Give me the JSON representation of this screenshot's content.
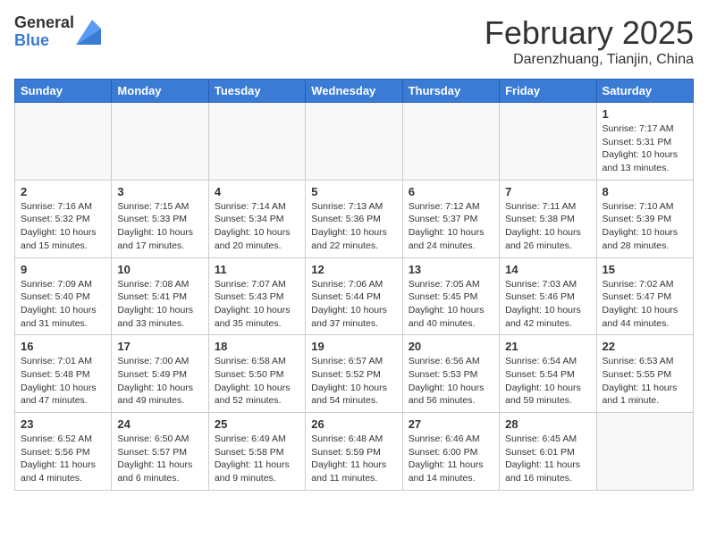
{
  "logo": {
    "general": "General",
    "blue": "Blue"
  },
  "title": "February 2025",
  "location": "Darenzhuang, Tianjin, China",
  "weekdays": [
    "Sunday",
    "Monday",
    "Tuesday",
    "Wednesday",
    "Thursday",
    "Friday",
    "Saturday"
  ],
  "weeks": [
    [
      {
        "day": "",
        "info": ""
      },
      {
        "day": "",
        "info": ""
      },
      {
        "day": "",
        "info": ""
      },
      {
        "day": "",
        "info": ""
      },
      {
        "day": "",
        "info": ""
      },
      {
        "day": "",
        "info": ""
      },
      {
        "day": "1",
        "info": "Sunrise: 7:17 AM\nSunset: 5:31 PM\nDaylight: 10 hours\nand 13 minutes."
      }
    ],
    [
      {
        "day": "2",
        "info": "Sunrise: 7:16 AM\nSunset: 5:32 PM\nDaylight: 10 hours\nand 15 minutes."
      },
      {
        "day": "3",
        "info": "Sunrise: 7:15 AM\nSunset: 5:33 PM\nDaylight: 10 hours\nand 17 minutes."
      },
      {
        "day": "4",
        "info": "Sunrise: 7:14 AM\nSunset: 5:34 PM\nDaylight: 10 hours\nand 20 minutes."
      },
      {
        "day": "5",
        "info": "Sunrise: 7:13 AM\nSunset: 5:36 PM\nDaylight: 10 hours\nand 22 minutes."
      },
      {
        "day": "6",
        "info": "Sunrise: 7:12 AM\nSunset: 5:37 PM\nDaylight: 10 hours\nand 24 minutes."
      },
      {
        "day": "7",
        "info": "Sunrise: 7:11 AM\nSunset: 5:38 PM\nDaylight: 10 hours\nand 26 minutes."
      },
      {
        "day": "8",
        "info": "Sunrise: 7:10 AM\nSunset: 5:39 PM\nDaylight: 10 hours\nand 28 minutes."
      }
    ],
    [
      {
        "day": "9",
        "info": "Sunrise: 7:09 AM\nSunset: 5:40 PM\nDaylight: 10 hours\nand 31 minutes."
      },
      {
        "day": "10",
        "info": "Sunrise: 7:08 AM\nSunset: 5:41 PM\nDaylight: 10 hours\nand 33 minutes."
      },
      {
        "day": "11",
        "info": "Sunrise: 7:07 AM\nSunset: 5:43 PM\nDaylight: 10 hours\nand 35 minutes."
      },
      {
        "day": "12",
        "info": "Sunrise: 7:06 AM\nSunset: 5:44 PM\nDaylight: 10 hours\nand 37 minutes."
      },
      {
        "day": "13",
        "info": "Sunrise: 7:05 AM\nSunset: 5:45 PM\nDaylight: 10 hours\nand 40 minutes."
      },
      {
        "day": "14",
        "info": "Sunrise: 7:03 AM\nSunset: 5:46 PM\nDaylight: 10 hours\nand 42 minutes."
      },
      {
        "day": "15",
        "info": "Sunrise: 7:02 AM\nSunset: 5:47 PM\nDaylight: 10 hours\nand 44 minutes."
      }
    ],
    [
      {
        "day": "16",
        "info": "Sunrise: 7:01 AM\nSunset: 5:48 PM\nDaylight: 10 hours\nand 47 minutes."
      },
      {
        "day": "17",
        "info": "Sunrise: 7:00 AM\nSunset: 5:49 PM\nDaylight: 10 hours\nand 49 minutes."
      },
      {
        "day": "18",
        "info": "Sunrise: 6:58 AM\nSunset: 5:50 PM\nDaylight: 10 hours\nand 52 minutes."
      },
      {
        "day": "19",
        "info": "Sunrise: 6:57 AM\nSunset: 5:52 PM\nDaylight: 10 hours\nand 54 minutes."
      },
      {
        "day": "20",
        "info": "Sunrise: 6:56 AM\nSunset: 5:53 PM\nDaylight: 10 hours\nand 56 minutes."
      },
      {
        "day": "21",
        "info": "Sunrise: 6:54 AM\nSunset: 5:54 PM\nDaylight: 10 hours\nand 59 minutes."
      },
      {
        "day": "22",
        "info": "Sunrise: 6:53 AM\nSunset: 5:55 PM\nDaylight: 11 hours\nand 1 minute."
      }
    ],
    [
      {
        "day": "23",
        "info": "Sunrise: 6:52 AM\nSunset: 5:56 PM\nDaylight: 11 hours\nand 4 minutes."
      },
      {
        "day": "24",
        "info": "Sunrise: 6:50 AM\nSunset: 5:57 PM\nDaylight: 11 hours\nand 6 minutes."
      },
      {
        "day": "25",
        "info": "Sunrise: 6:49 AM\nSunset: 5:58 PM\nDaylight: 11 hours\nand 9 minutes."
      },
      {
        "day": "26",
        "info": "Sunrise: 6:48 AM\nSunset: 5:59 PM\nDaylight: 11 hours\nand 11 minutes."
      },
      {
        "day": "27",
        "info": "Sunrise: 6:46 AM\nSunset: 6:00 PM\nDaylight: 11 hours\nand 14 minutes."
      },
      {
        "day": "28",
        "info": "Sunrise: 6:45 AM\nSunset: 6:01 PM\nDaylight: 11 hours\nand 16 minutes."
      },
      {
        "day": "",
        "info": ""
      }
    ]
  ]
}
